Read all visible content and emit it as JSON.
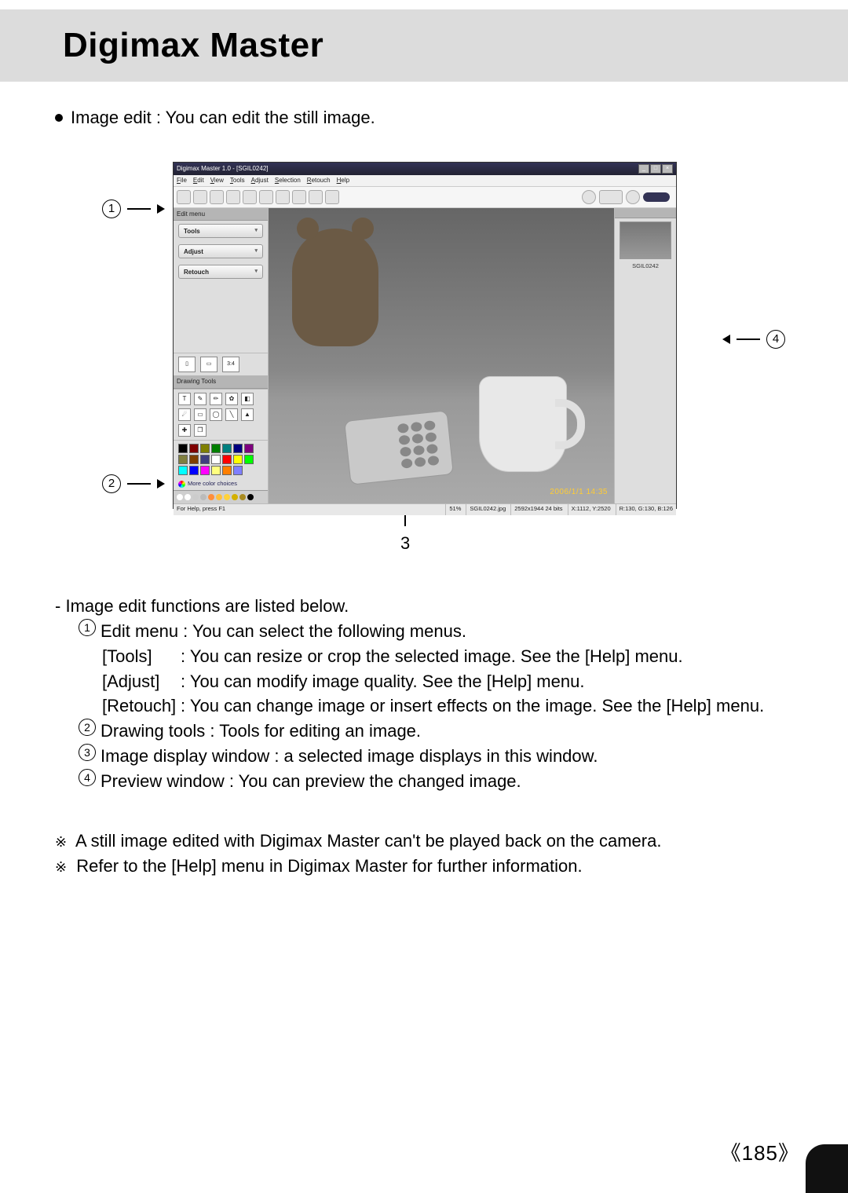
{
  "page": {
    "title": "Digimax Master",
    "bullet": "Image edit : You can edit the still image.",
    "number": "85"
  },
  "callouts": {
    "c1": "1",
    "c2": "2",
    "c3": "3",
    "c4": "4"
  },
  "app": {
    "titlebar": "Digimax Master 1.0 - [SGIL0242]",
    "menus": [
      "File",
      "Edit",
      "View",
      "Tools",
      "Adjust",
      "Selection",
      "Retouch",
      "Help"
    ],
    "left_panel_heading": "Edit menu",
    "accordion": {
      "tools": "Tools",
      "adjust": "Adjust",
      "retouch": "Retouch"
    },
    "more_colors": "More color choices",
    "drawing_heading": "Drawing Tools",
    "thumb_label": "SGIL0242",
    "timestamp": "2006/1/1  14:35",
    "status": {
      "help": "For Help, press F1",
      "zoom": "51%",
      "filename": "SGIL0242.jpg",
      "dims": "2592x1944 24 bits",
      "cursor": "X:1112, Y:2520",
      "rgb": "R:130, G:130, B:126"
    },
    "history_colors": [
      "#ffffff",
      "#ffffff",
      "#cccccc",
      "#bbbbbb",
      "#ff8e3a",
      "#ffbf3a",
      "#ffd23a",
      "#d4b000",
      "#a88a20",
      "#000000"
    ],
    "swatches_row1": [
      "#000",
      "#7f0000",
      "#7f7f00",
      "#007f00",
      "#007f7f",
      "#00007f",
      "#7f007f",
      "#7f7f3f",
      "#7f3f00",
      "#3f3f7f"
    ],
    "swatches_row2": [
      "#fff",
      "#ff0000",
      "#ffff00",
      "#00ff00",
      "#00ffff",
      "#0000ff",
      "#ff00ff",
      "#ffff7f",
      "#ff7f00",
      "#7f7fff"
    ]
  },
  "list": {
    "intro": "Image edit functions are listed below.",
    "i1_lead": "Edit menu : You can select the following menus.",
    "tools": {
      "label": "[Tools]",
      "desc": ": You can resize or crop the selected image. See the [Help] menu."
    },
    "adjust": {
      "label": "[Adjust]",
      "desc": ": You can modify image quality. See the [Help] menu."
    },
    "retouch": {
      "label": "[Retouch]",
      "desc": ": You can change image or insert effects on the image. See the [Help] menu."
    },
    "i2": "Drawing tools : Tools for editing an image.",
    "i3": "Image display window : a selected image displays in this window.",
    "i4": "Preview window : You can preview the changed image."
  },
  "notes": {
    "n1": "A still image edited with Digimax Master can't be played back on the camera.",
    "n2": "Refer to the [Help] menu in Digimax Master for further information."
  }
}
